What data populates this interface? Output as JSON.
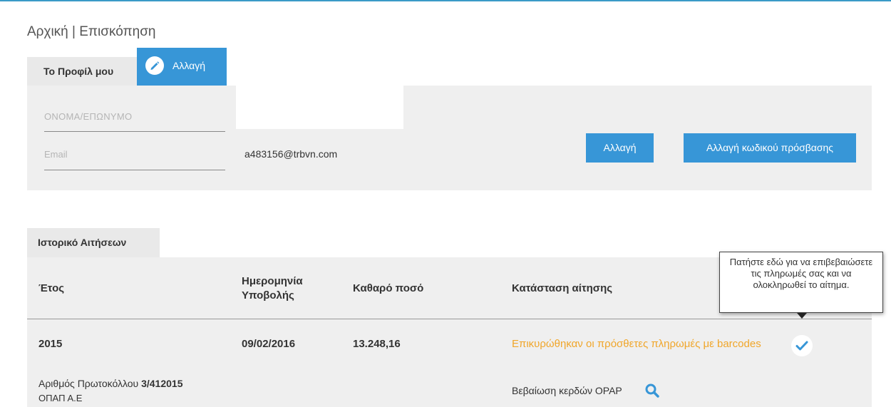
{
  "breadcrumb": "Αρχική | Επισκόπηση",
  "profile": {
    "tab_label": "Το Προφίλ μου",
    "edit_tab_label": "Αλλαγή",
    "name_placeholder": "ΟΝΟΜΑ/ΕΠΩΝΥΜΟ",
    "email_label": "Email",
    "email_value": "a483156@trbvn.com",
    "change_button": "Αλλαγή",
    "password_button": "Αλλαγή κωδικού πρόσβασης"
  },
  "history": {
    "tab_label": "Ιστορικό Αιτήσεων",
    "columns": {
      "year": "Έτος",
      "date_line1": "Ημερομηνία",
      "date_line2": "Υποβολής",
      "amount": "Καθαρό ποσό",
      "status": "Κατάσταση αίτησης"
    },
    "row": {
      "year": "2015",
      "date": "09/02/2016",
      "amount": "13.248,16",
      "status": "Επικυρώθηκαν οι πρόσθετες πληρωμές με barcodes",
      "protocol_label": "Αριθμός Πρωτοκόλλου",
      "protocol_number": "3/412015",
      "organization": "ΟΠΑΠ Α.Ε",
      "certificate": "Βεβαίωση κερδών OPAP"
    }
  },
  "tooltip": "Πατήστε εδώ για να επιβεβαιώσετε τις πληρωμές σας και να ολοκληρωθεί το αίτημα.",
  "colors": {
    "accent": "#3796d7",
    "status_orange": "#f0a62a",
    "panel_gray": "#efefef"
  },
  "icons": [
    "pencil-icon",
    "check-icon",
    "search-icon"
  ]
}
